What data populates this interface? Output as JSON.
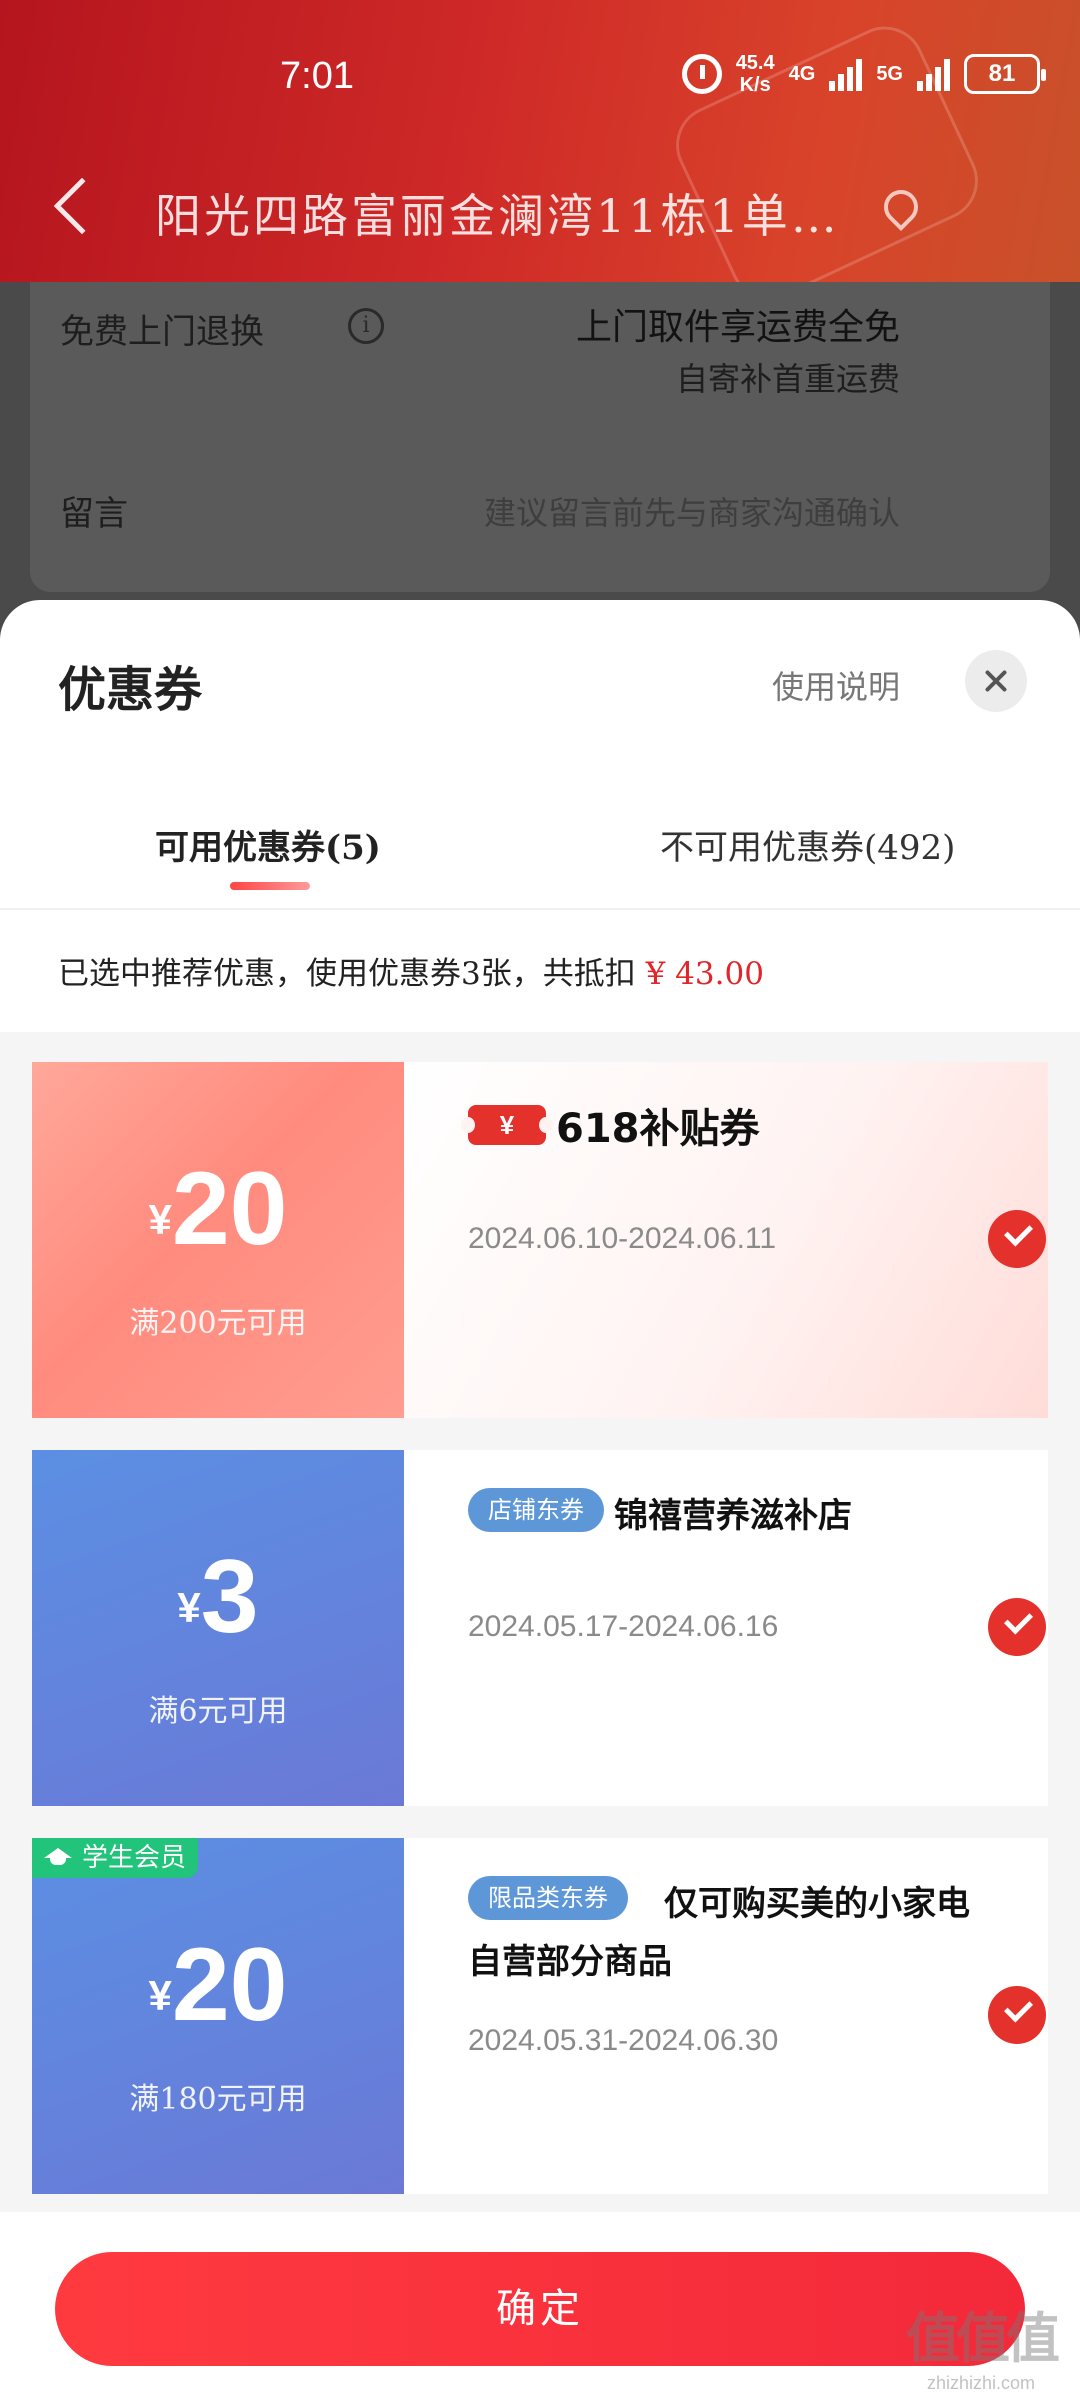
{
  "status_bar": {
    "time": "7:01",
    "speed_value": "45.4",
    "speed_unit": "K/s",
    "net1": "4G",
    "net2": "5G",
    "battery": "81"
  },
  "nav": {
    "title": "阳光四路富丽金澜湾11栋1单…"
  },
  "background_form": {
    "return_label": "免费上门退换",
    "return_value_main": "上门取件享运费全免",
    "return_value_sub": "自寄补首重运费",
    "message_label": "留言",
    "message_placeholder": "建议留言前先与商家沟通确认"
  },
  "sheet": {
    "title": "优惠券",
    "usage_link": "使用说明",
    "tabs": [
      {
        "label": "可用优惠券(5)"
      },
      {
        "label": "不可用优惠券(492)"
      }
    ],
    "summary_text": "已选中推荐优惠，使用优惠券3张，共抵扣",
    "summary_amount": "¥ 43.00"
  },
  "coupons": [
    {
      "symbol": "¥",
      "amount": "20",
      "threshold": "满200元可用",
      "badge": "¥",
      "title": "618补贴券",
      "date": "2024.06.10-2024.06.11",
      "selected": true
    },
    {
      "symbol": "¥",
      "amount": "3",
      "threshold": "满6元可用",
      "tag": "店铺东券",
      "title": "锦禧营养滋补店",
      "date": "2024.05.17-2024.06.16",
      "selected": true
    },
    {
      "symbol": "¥",
      "amount": "20",
      "threshold": "满180元可用",
      "student_badge": "学生会员",
      "tag": "限品类东券",
      "title": "仅可购买美的小家电",
      "title_line2": "自营部分商品",
      "date": "2024.05.31-2024.06.30",
      "selected": true
    }
  ],
  "confirm_label": "确定",
  "watermark": {
    "main": "值值值",
    "sub": "zhizhizhi.com"
  },
  "colors": {
    "primary_red": "#e5312c",
    "summary_amount": "#e0262a",
    "blue_tag": "#5d97d8",
    "student_green": "#22c37a"
  }
}
